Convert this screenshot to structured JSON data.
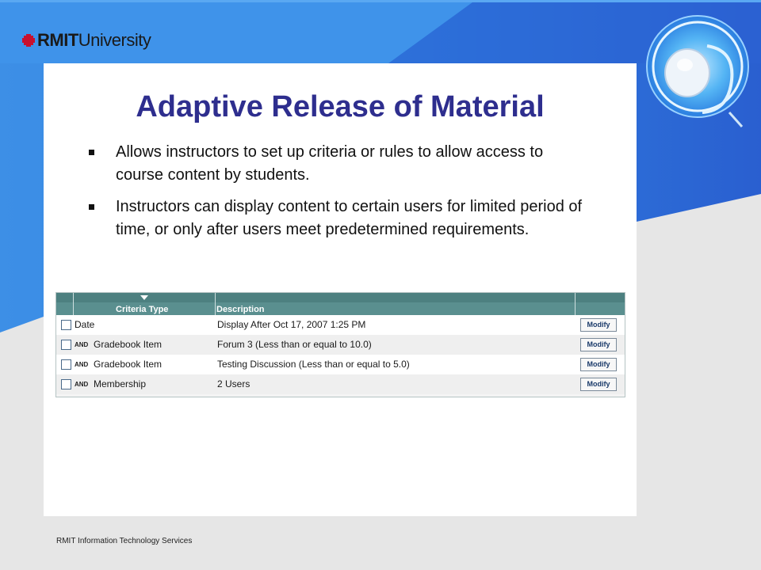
{
  "brand": {
    "logo_bold": "RMIT",
    "logo_regular": "University",
    "accent_red": "#c8102e",
    "header_blue": "#3b8fe8",
    "title_color": "#2e2e8e"
  },
  "slide": {
    "title": "Adaptive Release of Material",
    "bullets": [
      "Allows instructors to set up criteria or rules to allow access to course content by students.",
      "Instructors can display content to certain users for limited period of time, or only after users meet predetermined requirements."
    ]
  },
  "criteria_table": {
    "columns": [
      "Criteria Type",
      "Description"
    ],
    "rows": [
      {
        "connector": "",
        "type": "Date",
        "description": "Display After Oct 17, 2007 1:25 PM",
        "action": "Modify"
      },
      {
        "connector": "AND",
        "type": "Gradebook Item",
        "description": "Forum 3 (Less than or equal to 10.0)",
        "action": "Modify"
      },
      {
        "connector": "AND",
        "type": "Gradebook Item",
        "description": "Testing Discussion (Less than or equal to 5.0)",
        "action": "Modify"
      },
      {
        "connector": "AND",
        "type": "Membership",
        "description": "2 Users",
        "action": "Modify"
      }
    ]
  },
  "footer": {
    "text": "RMIT Information Technology Services"
  },
  "icons": {
    "logo_mark": "rmit-pixel-icon",
    "emblem": "mouse-at-sign-icon",
    "bullet": "square-bullet-icon",
    "sort": "sort-down-arrow-icon"
  }
}
